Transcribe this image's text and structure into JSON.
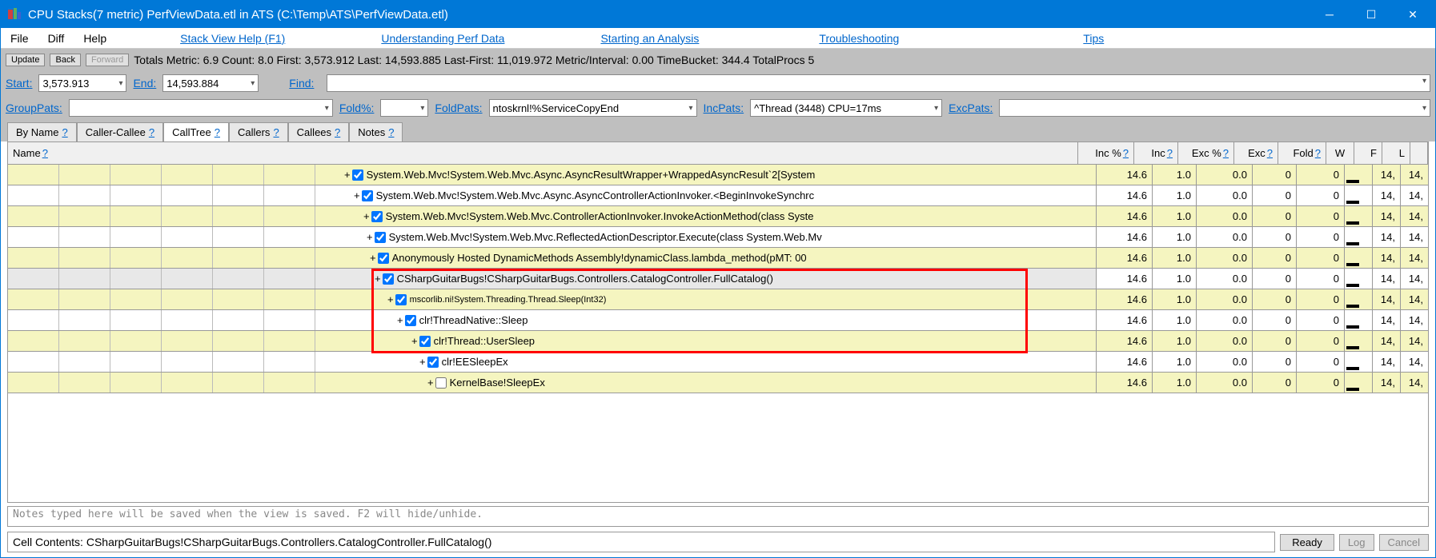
{
  "window": {
    "title": "CPU Stacks(7 metric) PerfViewData.etl in ATS (C:\\Temp\\ATS\\PerfViewData.etl)"
  },
  "menu": {
    "file": "File",
    "diff": "Diff",
    "help": "Help",
    "links": {
      "stack_view_help": "Stack View Help (F1)",
      "understanding": "Understanding Perf Data",
      "starting": "Starting an Analysis",
      "troubleshooting": "Troubleshooting",
      "tips": "Tips"
    }
  },
  "toolbar1": {
    "update": "Update",
    "back": "Back",
    "forward": "Forward",
    "totals": "Totals Metric: 6.9  Count: 8.0  First: 3,573.912  Last: 14,593.885  Last-First: 11,019.972   Metric/Interval: 0.00   TimeBucket: 344.4  TotalProcs 5"
  },
  "toolbar2": {
    "start_label": "Start:",
    "start_value": "3,573.913",
    "end_label": "End:",
    "end_value": "14,593.884",
    "find_label": "Find:"
  },
  "toolbar3": {
    "grouppats_label": "GroupPats:",
    "foldpct_label": "Fold%:",
    "foldpats_label": "FoldPats:",
    "foldpats_value": "ntoskrnl!%ServiceCopyEnd",
    "incpats_label": "IncPats:",
    "incpats_value": "^Thread (3448) CPU=17ms",
    "excpats_label": "ExcPats:"
  },
  "tabs": {
    "byname": "By Name",
    "callercallee": "Caller-Callee",
    "calltree": "CallTree",
    "callers": "Callers",
    "callees": "Callees",
    "notes": "Notes",
    "q": "?"
  },
  "columns": {
    "name": "Name",
    "incpct": "Inc %",
    "inc": "Inc",
    "excpct": "Exc %",
    "exc": "Exc",
    "fold": "Fold",
    "w": "W",
    "f": "F",
    "l": "L",
    "q": "?"
  },
  "rows": [
    {
      "indent": 6,
      "checked": true,
      "text": "System.Web.Mvc!System.Web.Mvc.Async.AsyncResultWrapper+WrappedAsyncResult`2[System",
      "incpct": "14.6",
      "inc": "1.0",
      "excpct": "0.0",
      "exc": "0",
      "fold": "0",
      "f": "14,",
      "l": "14,"
    },
    {
      "indent": 6,
      "checked": true,
      "text": "System.Web.Mvc!System.Web.Mvc.Async.AsyncControllerActionInvoker.<BeginInvokeSynchrc",
      "incpct": "14.6",
      "inc": "1.0",
      "excpct": "0.0",
      "exc": "0",
      "fold": "0",
      "f": "14,",
      "l": "14,"
    },
    {
      "indent": 6,
      "checked": true,
      "text": "System.Web.Mvc!System.Web.Mvc.ControllerActionInvoker.InvokeActionMethod(class Syste",
      "incpct": "14.6",
      "inc": "1.0",
      "excpct": "0.0",
      "exc": "0",
      "fold": "0",
      "f": "14,",
      "l": "14,"
    },
    {
      "indent": 6,
      "checked": true,
      "text": "System.Web.Mvc!System.Web.Mvc.ReflectedActionDescriptor.Execute(class System.Web.Mv",
      "incpct": "14.6",
      "inc": "1.0",
      "excpct": "0.0",
      "exc": "0",
      "fold": "0",
      "f": "14,",
      "l": "14,"
    },
    {
      "indent": 6,
      "checked": true,
      "text": "Anonymously Hosted DynamicMethods Assembly!dynamicClass.lambda_method(pMT: 00",
      "incpct": "14.6",
      "inc": "1.0",
      "excpct": "0.0",
      "exc": "0",
      "fold": "0",
      "f": "14,",
      "l": "14,"
    },
    {
      "indent": 6,
      "checked": true,
      "text": "CSharpGuitarBugs!CSharpGuitarBugs.Controllers.CatalogController.FullCatalog()",
      "incpct": "14.6",
      "inc": "1.0",
      "excpct": "0.0",
      "exc": "0",
      "fold": "0",
      "f": "14,",
      "l": "14,",
      "selected": true
    },
    {
      "indent": 6,
      "checked": true,
      "text": "mscorlib.ni!System.Threading.Thread.Sleep(Int32)",
      "incpct": "14.6",
      "inc": "1.0",
      "excpct": "0.0",
      "exc": "0",
      "fold": "0",
      "f": "14,",
      "l": "14,",
      "small": true
    },
    {
      "indent": 6,
      "checked": true,
      "text": "clr!ThreadNative::Sleep",
      "incpct": "14.6",
      "inc": "1.0",
      "excpct": "0.0",
      "exc": "0",
      "fold": "0",
      "f": "14,",
      "l": "14,"
    },
    {
      "indent": 6,
      "checked": true,
      "text": "clr!Thread::UserSleep",
      "incpct": "14.6",
      "inc": "1.0",
      "excpct": "0.0",
      "exc": "0",
      "fold": "0",
      "f": "14,",
      "l": "14,"
    },
    {
      "indent": 6,
      "checked": true,
      "text": "clr!EESleepEx",
      "incpct": "14.6",
      "inc": "1.0",
      "excpct": "0.0",
      "exc": "0",
      "fold": "0",
      "f": "14,",
      "l": "14,"
    },
    {
      "indent": 6,
      "checked": false,
      "text": "KernelBase!SleepEx",
      "incpct": "14.6",
      "inc": "1.0",
      "excpct": "0.0",
      "exc": "0",
      "fold": "0",
      "f": "14,",
      "l": "14,"
    }
  ],
  "tree_offsets": [
    420,
    432,
    444,
    448,
    452,
    458,
    474,
    486,
    504,
    514,
    524
  ],
  "notes_placeholder": "Notes typed here will be saved when the view is saved. F2 will hide/unhide.",
  "statusbar": {
    "cell_contents_label": "Cell Contents:",
    "cell_contents_value": "CSharpGuitarBugs!CSharpGuitarBugs.Controllers.CatalogController.FullCatalog()",
    "ready": "Ready",
    "log": "Log",
    "cancel": "Cancel"
  }
}
